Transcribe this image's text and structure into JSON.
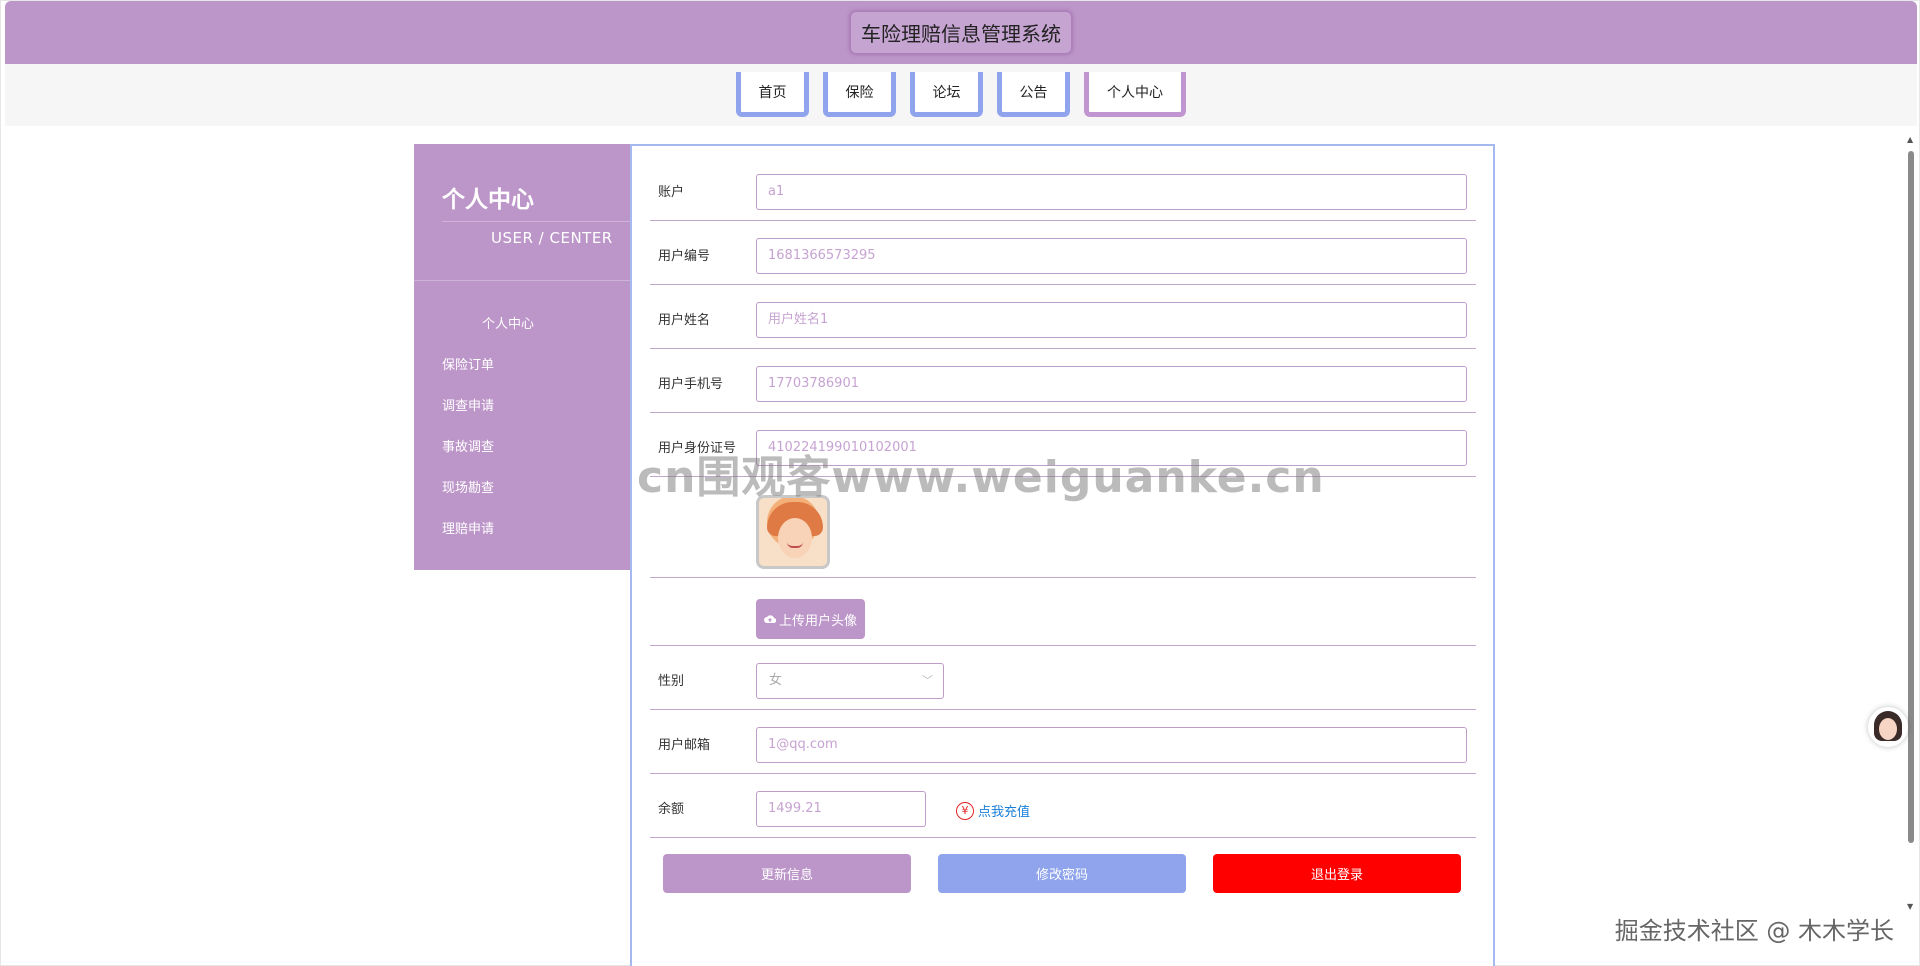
{
  "app": {
    "title": "车险理赔信息管理系统"
  },
  "nav": {
    "items": [
      {
        "label": "首页"
      },
      {
        "label": "保险"
      },
      {
        "label": "论坛"
      },
      {
        "label": "公告"
      },
      {
        "label": "个人中心"
      }
    ]
  },
  "sidebar": {
    "title": "个人中心",
    "subtitle": "USER / CENTER",
    "items": [
      {
        "label": "个人中心"
      },
      {
        "label": "保险订单"
      },
      {
        "label": "调查申请"
      },
      {
        "label": "事故调查"
      },
      {
        "label": "现场勘查"
      },
      {
        "label": "理赔申请"
      }
    ]
  },
  "form": {
    "account": {
      "label": "账户",
      "value": "a1"
    },
    "user_no": {
      "label": "用户编号",
      "value": "1681366573295"
    },
    "user_name": {
      "label": "用户姓名",
      "value": "用户姓名1"
    },
    "phone": {
      "label": "用户手机号",
      "value": "17703786901"
    },
    "id_card": {
      "label": "用户身份证号",
      "value": "410224199010102001"
    },
    "upload_label": "上传用户头像",
    "gender": {
      "label": "性别",
      "value": "女"
    },
    "email": {
      "label": "用户邮箱",
      "value": "1@qq.com"
    },
    "balance": {
      "label": "余额",
      "value": "1499.21",
      "recharge_label": "点我充值",
      "recharge_icon": "¥"
    }
  },
  "actions": {
    "update": "更新信息",
    "change_password": "修改密码",
    "logout": "退出登录"
  },
  "colors": {
    "primary": "#bd96c9",
    "secondary": "#8fa4ec",
    "danger": "#ff0000",
    "link": "#1a7fd8"
  },
  "overlay": {
    "watermark": "cn围观客www.weiguanke.cn",
    "credit": "掘金技术社区 @ 木木学长"
  }
}
